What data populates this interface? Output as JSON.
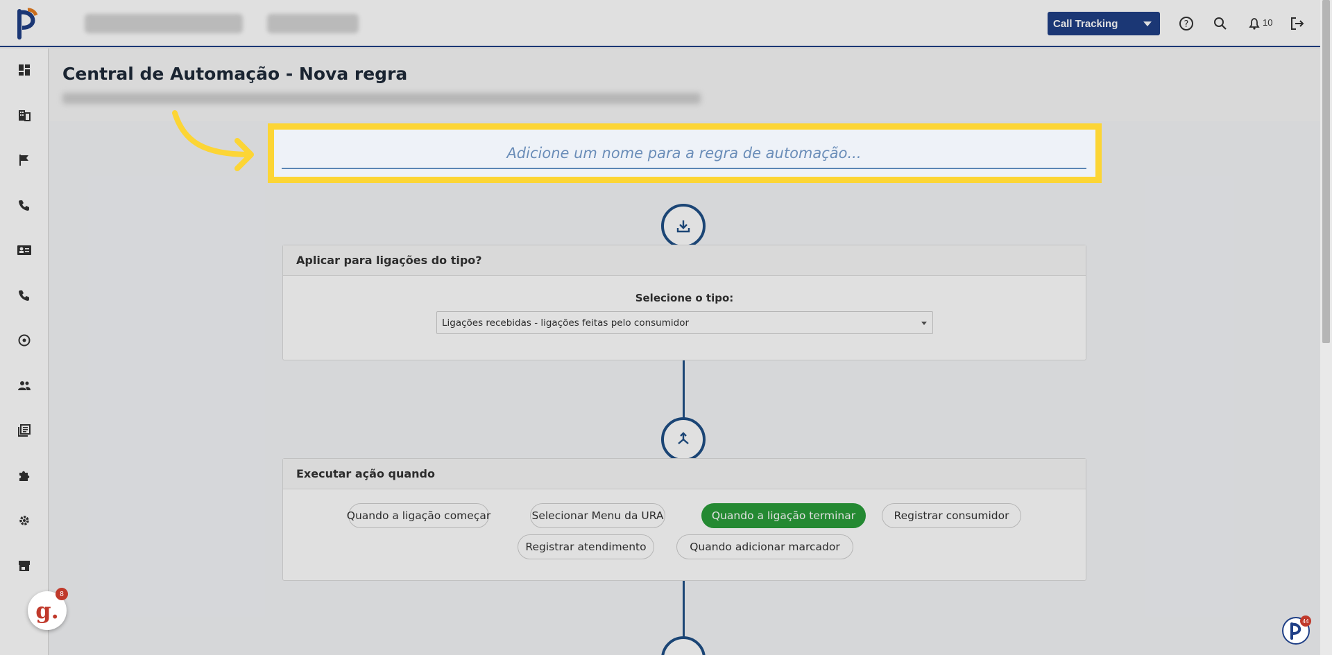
{
  "topbar": {
    "product_select": "Call Tracking",
    "notification_count": "10"
  },
  "page": {
    "title": "Central de Automação - Nova regra"
  },
  "rule_name": {
    "placeholder": "Adicione um nome para a regra de automação..."
  },
  "call_type_card": {
    "header": "Aplicar para ligações do tipo?",
    "select_label": "Selecione o tipo:",
    "selected_value": "Ligações recebidas - ligações feitas pelo consumidor"
  },
  "trigger_card": {
    "header": "Executar ação quando",
    "options": [
      {
        "label": "Quando a ligação começar",
        "active": false
      },
      {
        "label": "Selecionar Menu da URA",
        "active": false
      },
      {
        "label": "Quando a ligação terminar",
        "active": true
      },
      {
        "label": "Registrar consumidor",
        "active": false
      },
      {
        "label": "Registrar atendimento",
        "active": false
      },
      {
        "label": "Quando adicionar marcador",
        "active": false
      }
    ]
  },
  "widgets": {
    "g_badge_letter": "g.",
    "g_badge_count": "8",
    "p_badge_count": "44"
  },
  "colors": {
    "brand_blue": "#1f3f86",
    "highlight_yellow": "#fcd535",
    "active_green": "#2a9d3a"
  }
}
